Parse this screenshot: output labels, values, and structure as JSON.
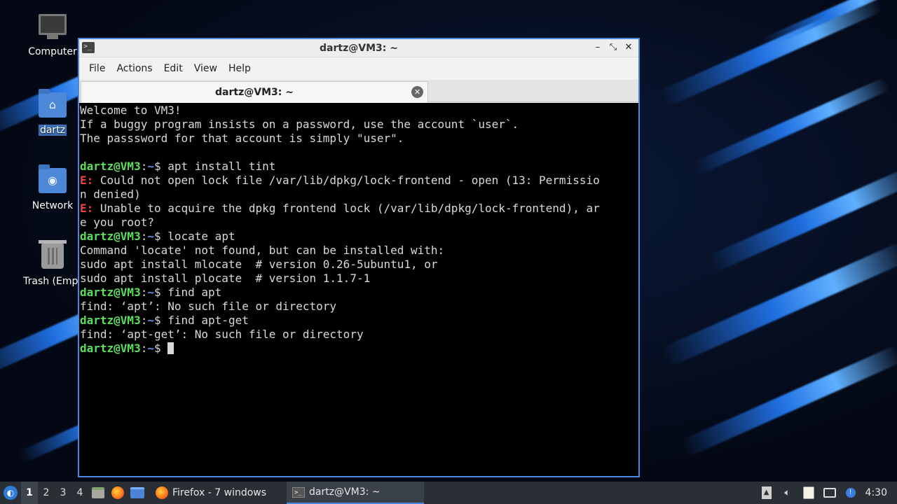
{
  "desktop": {
    "icons": [
      {
        "label": "Computer",
        "icon": "computer-icon"
      },
      {
        "label": "dartz",
        "icon": "home-folder-icon"
      },
      {
        "label": "Network",
        "icon": "network-folder-icon"
      },
      {
        "label": "Trash (Empt",
        "icon": "trash-icon"
      }
    ]
  },
  "window": {
    "title": "dartz@VM3: ~",
    "controls": {
      "minimize": "–",
      "maximize": "⤡",
      "close": "✕"
    },
    "menu": [
      "File",
      "Actions",
      "Edit",
      "View",
      "Help"
    ],
    "tab": {
      "label": "dartz@VM3: ~",
      "close": "✕"
    }
  },
  "terminal": {
    "prompt": {
      "user": "dartz@VM3",
      "sep": ":",
      "path": "~",
      "sym": "$ "
    },
    "lines": [
      {
        "type": "text",
        "text": "Welcome to VM3!"
      },
      {
        "type": "text",
        "text": "If a buggy program insists on a password, use the account `user`."
      },
      {
        "type": "text",
        "text": "The passsword for that account is simply \"user\"."
      },
      {
        "type": "text",
        "text": ""
      },
      {
        "type": "cmd",
        "text": "apt install tint"
      },
      {
        "type": "err",
        "tag": "E:",
        "text": " Could not open lock file /var/lib/dpkg/lock-frontend - open (13: Permissio"
      },
      {
        "type": "text",
        "text": "n denied)"
      },
      {
        "type": "err",
        "tag": "E:",
        "text": " Unable to acquire the dpkg frontend lock (/var/lib/dpkg/lock-frontend), ar"
      },
      {
        "type": "text",
        "text": "e you root?"
      },
      {
        "type": "cmd",
        "text": "locate apt"
      },
      {
        "type": "text",
        "text": "Command 'locate' not found, but can be installed with:"
      },
      {
        "type": "text",
        "text": "sudo apt install mlocate  # version 0.26-5ubuntu1, or"
      },
      {
        "type": "text",
        "text": "sudo apt install plocate  # version 1.1.7-1"
      },
      {
        "type": "cmd",
        "text": "find apt"
      },
      {
        "type": "text",
        "text": "find: ‘apt’: No such file or directory"
      },
      {
        "type": "cmd",
        "text": "find apt-get"
      },
      {
        "type": "text",
        "text": "find: ‘apt-get’: No such file or directory"
      },
      {
        "type": "prompt_cursor",
        "text": ""
      }
    ]
  },
  "taskbar": {
    "start_icon": "lubuntu-logo-icon",
    "workspaces": [
      "1",
      "2",
      "3",
      "4"
    ],
    "active_workspace": "1",
    "launchers": [
      "file-manager-icon",
      "firefox-icon",
      "show-desktop-icon"
    ],
    "tasks": [
      {
        "label": "Firefox - 7 windows",
        "icon": "firefox-icon"
      },
      {
        "label": "dartz@VM3: ~",
        "icon": "terminal-icon",
        "active": true
      }
    ],
    "tray": [
      "keyboard-layout-icon",
      "volume-icon",
      "clipboard-icon",
      "screenshot-icon",
      "update-notifier-icon"
    ],
    "clock": "4:30"
  },
  "colors": {
    "window_border": "#4a88e0",
    "prompt_user": "#5ede5e",
    "prompt_path": "#6b8ff0",
    "error": "#ee4444",
    "terminal_bg": "#000000",
    "taskbar_bg": "#2a2f36"
  }
}
